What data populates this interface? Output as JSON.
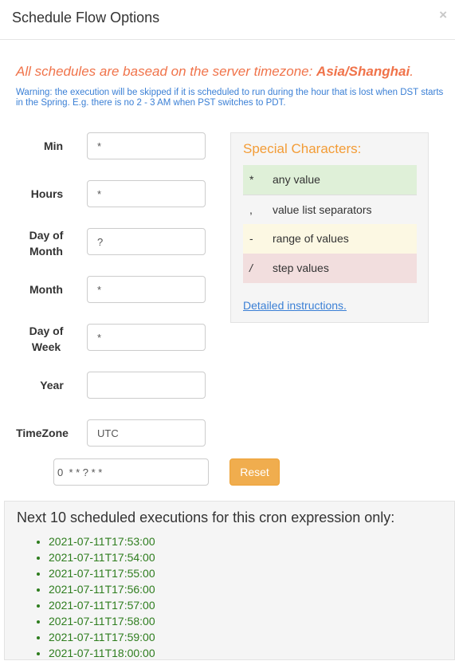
{
  "modal": {
    "title": "Schedule Flow Options",
    "close_glyph": "×"
  },
  "timezone_notice": {
    "prefix": "All schedules are basead on the server timezone: ",
    "zone": "Asia/Shanghai",
    "suffix": "."
  },
  "warning": "Warning: the execution will be skipped if it is scheduled to run during the hour that is lost when DST starts in the Spring. E.g. there is no 2 - 3 AM when PST switches to PDT.",
  "fields": {
    "min": {
      "label": "Min",
      "value": "*"
    },
    "hours": {
      "label": "Hours",
      "value": "*"
    },
    "day_of_month": {
      "label_line1": "Day of",
      "label_line2": "Month",
      "value": "?"
    },
    "month": {
      "label": "Month",
      "value": "*"
    },
    "day_of_week": {
      "label_line1": "Day of",
      "label_line2": "Week",
      "value": "*"
    },
    "year": {
      "label": "Year",
      "value": ""
    },
    "timezone": {
      "label": "TimeZone",
      "value": "UTC"
    }
  },
  "cron_expression": "0  * * ? * *",
  "reset_label": "Reset",
  "special_characters": {
    "title": "Special Characters:",
    "rows": [
      {
        "symbol": "*",
        "description": "any value"
      },
      {
        "symbol": ",",
        "description": "value list separators"
      },
      {
        "symbol": "-",
        "description": "range of values"
      },
      {
        "symbol": "/",
        "description": "step values"
      }
    ],
    "link": "Detailed instructions."
  },
  "next_executions": {
    "title": "Next 10 scheduled executions for this cron expression only:",
    "items": [
      "2021-07-11T17:53:00",
      "2021-07-11T17:54:00",
      "2021-07-11T17:55:00",
      "2021-07-11T17:56:00",
      "2021-07-11T17:57:00",
      "2021-07-11T17:58:00",
      "2021-07-11T17:59:00",
      "2021-07-11T18:00:00"
    ]
  },
  "colors": {
    "accent_orange": "#f0734a",
    "warning_blue": "#3a7fd5",
    "reset_button": "#f0ad4e",
    "list_green": "#2e7d1e"
  }
}
